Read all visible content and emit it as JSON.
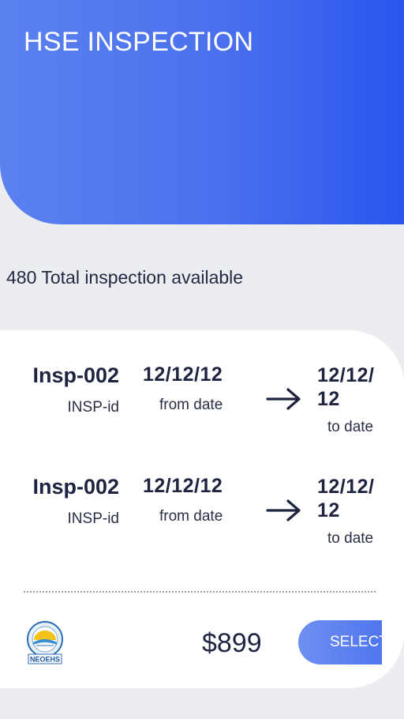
{
  "header": {
    "title": "HSE INSPECTION"
  },
  "summary": {
    "text": "480 Total inspection available"
  },
  "inspections": [
    {
      "id": "Insp-002",
      "id_label": "INSP-id",
      "from_date": "12/12/12",
      "from_label": "from date",
      "to_date": "12/12/12",
      "to_label": "to date"
    },
    {
      "id": "Insp-002",
      "id_label": "INSP-id",
      "from_date": "12/12/12",
      "from_label": "from date",
      "to_date": "12/12/12",
      "to_label": "to date"
    }
  ],
  "footer": {
    "logo_icon": "neo-ehs-logo-icon",
    "logo_text": "NEOEHS",
    "price": "$899",
    "select_label": "SELECT"
  },
  "colors": {
    "header_start": "#5b82ef",
    "header_end": "#2a56ee",
    "text_dark": "#1e2440",
    "background": "#ebedf1",
    "button": "#5b7ff0"
  }
}
